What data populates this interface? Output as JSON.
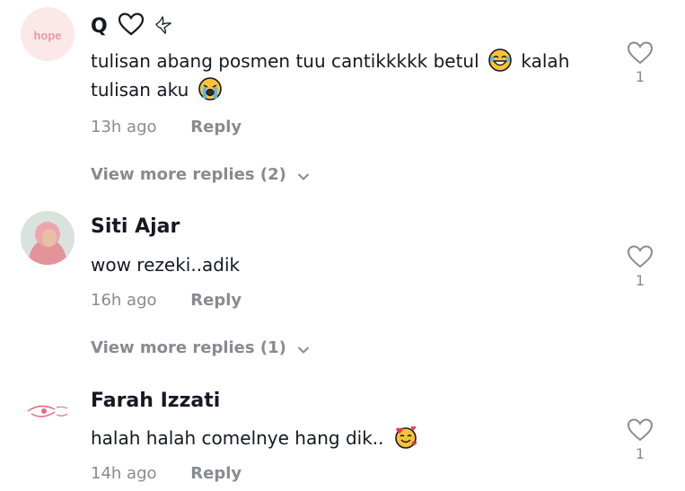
{
  "comments": [
    {
      "username": "Q",
      "text_parts": [
        "tulisan abang posmen tuu cantikkkkk betul",
        "kalah",
        "tulisan aku"
      ],
      "time": "13h ago",
      "reply_label": "Reply",
      "like_count": "1",
      "more_replies": "View more replies (2)",
      "avatar_text": "hope"
    },
    {
      "username": "Siti Ajar",
      "text": "wow rezeki..adik",
      "time": "16h ago",
      "reply_label": "Reply",
      "like_count": "1",
      "more_replies": "View more replies (1)"
    },
    {
      "username": "Farah Izzati",
      "text": "halah halah comelnye hang dik..",
      "time": "14h ago",
      "reply_label": "Reply",
      "like_count": "1"
    }
  ],
  "colors": {
    "text": "#161823",
    "muted": "#8a8b91",
    "avatar_bg": "#fbe9ea"
  },
  "icons": [
    "heart-icon",
    "dove-icon",
    "chevron-down-icon",
    "joy-emoji-icon",
    "crying-emoji-icon",
    "smiling-hearts-emoji-icon",
    "heart-outline-like-icon"
  ]
}
